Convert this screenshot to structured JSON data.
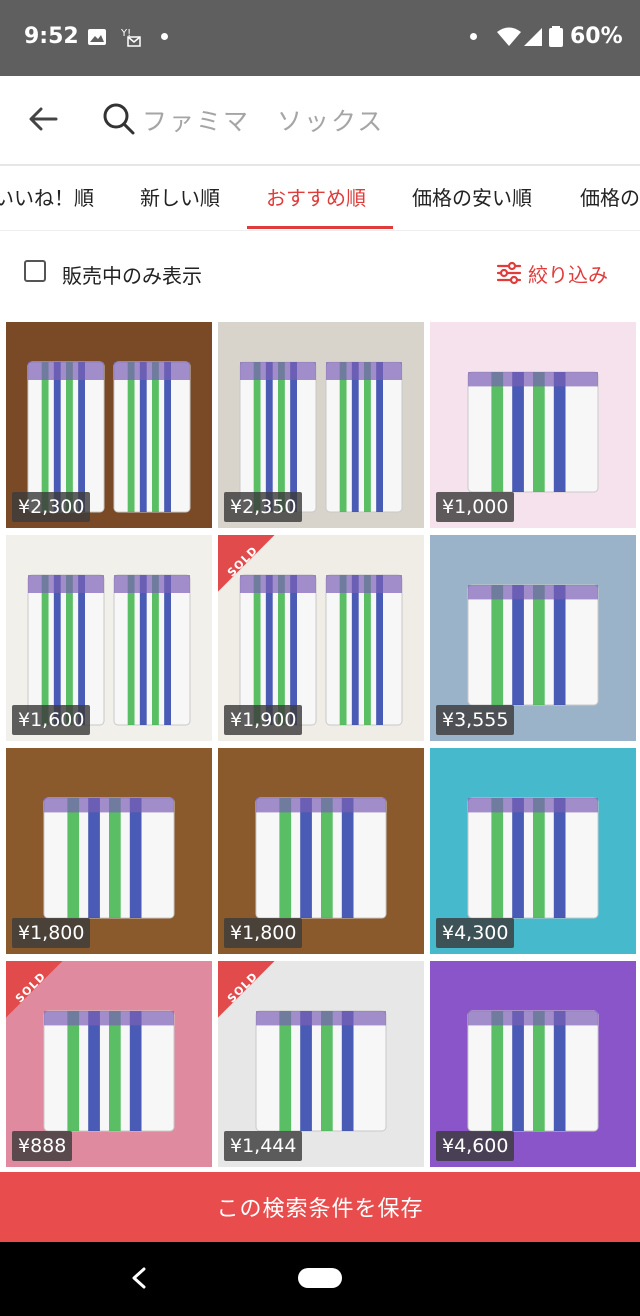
{
  "status_bar": {
    "time": "9:52",
    "battery": "60%"
  },
  "search": {
    "query": "ファミマ　ソックス"
  },
  "sort_tabs": [
    {
      "label": "いいね！順"
    },
    {
      "label": "新しい順"
    },
    {
      "label": "おすすめ順",
      "active": true
    },
    {
      "label": "価格の安い順"
    },
    {
      "label": "価格の"
    }
  ],
  "filter": {
    "on_sale_only_label": "販売中のみ表示",
    "refine_label": "絞り込み"
  },
  "products": [
    {
      "price": "¥2,300",
      "sold": false
    },
    {
      "price": "¥2,350",
      "sold": false
    },
    {
      "price": "¥1,000",
      "sold": false
    },
    {
      "price": "¥1,600",
      "sold": false
    },
    {
      "price": "¥1,900",
      "sold": true
    },
    {
      "price": "¥3,555",
      "sold": false
    },
    {
      "price": "¥1,800",
      "sold": false
    },
    {
      "price": "¥1,800",
      "sold": false
    },
    {
      "price": "¥4,300",
      "sold": false
    },
    {
      "price": "¥888",
      "sold": true
    },
    {
      "price": "¥1,444",
      "sold": true
    },
    {
      "price": "¥4,600",
      "sold": false
    }
  ],
  "sold_label": "SOLD",
  "save_bar": {
    "label": "この検索条件を保存"
  },
  "colors": {
    "accent": "#e03c3c",
    "save_bar": "#e84c4c",
    "status_bar": "#5f5f5f"
  }
}
